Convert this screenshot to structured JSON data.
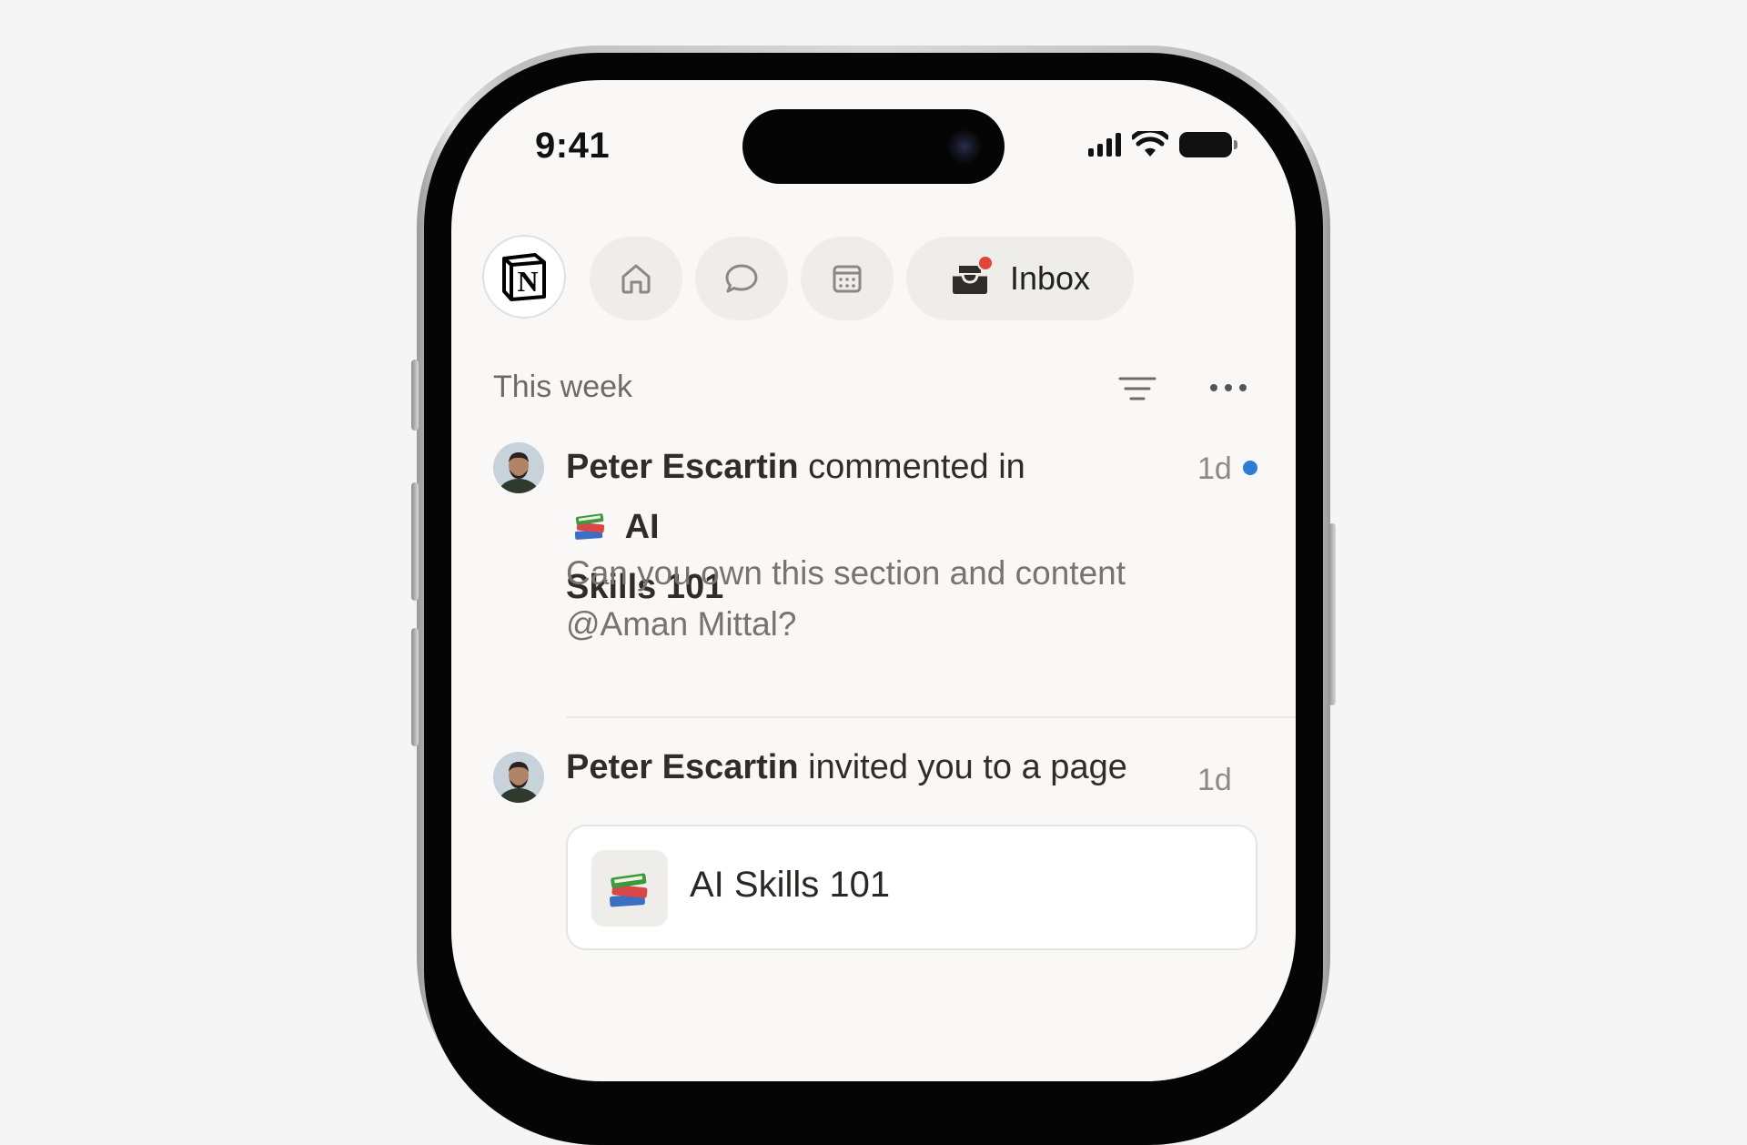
{
  "status_bar": {
    "time": "9:41"
  },
  "topnav": {
    "logo_letter": "N",
    "items": [
      {
        "icon": "home-icon"
      },
      {
        "icon": "chat-bubble-icon"
      },
      {
        "icon": "calendar-icon"
      }
    ],
    "inbox": {
      "label": "Inbox",
      "icon": "inbox-tray-icon",
      "has_badge": true
    }
  },
  "section": {
    "title": "This week"
  },
  "notifications": [
    {
      "actor": "Peter Escartin",
      "action": "commented in",
      "page_icon": "books-emoji",
      "page_part1": "AI",
      "page_part2": "Skills 101",
      "time": "1d",
      "unread": true,
      "comment_line1": "Can you own this section and content",
      "comment_line2": "@Aman Mittal?"
    },
    {
      "actor": "Peter Escartin",
      "action": "invited you to a page",
      "time": "1d",
      "unread": false,
      "page_card_title": "AI Skills 101",
      "page_card_icon": "books-emoji"
    }
  ],
  "colors": {
    "background": "#f5f5f6",
    "screen": "#f9f8f7",
    "pill": "#efedea",
    "unread_dot": "#2d7bd6",
    "inbox_badge": "#e0453b"
  }
}
